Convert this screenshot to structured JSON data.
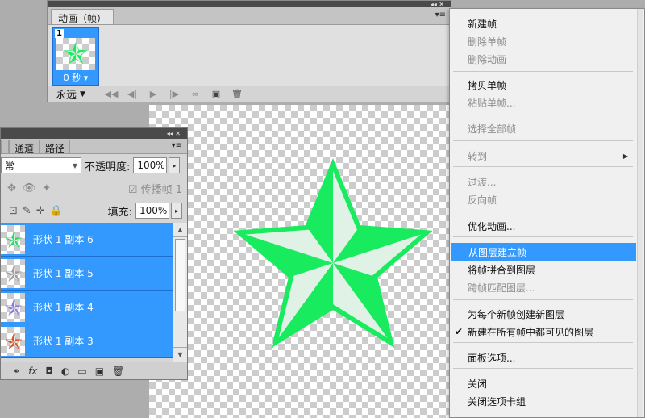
{
  "animation_panel": {
    "tab": "动画（帧）",
    "frame": {
      "number": "1",
      "delay": "0 秒"
    },
    "loop": "永远"
  },
  "layers_panel": {
    "tabs": [
      "",
      "通道",
      "路径"
    ],
    "blend_mode": "常",
    "opacity_label": "不透明度:",
    "opacity_value": "100%",
    "propagate_label": "传播帧 1",
    "fill_label": "填充:",
    "fill_value": "100%",
    "layers": [
      {
        "name": "形状 1 副本 6",
        "star_color": "#2fd36a"
      },
      {
        "name": "形状 1 副本 5",
        "star_color": "#9a9a9a"
      },
      {
        "name": "形状 1 副本 4",
        "star_color": "#8a7ad8"
      },
      {
        "name": "形状 1 副本 3",
        "star_color": "#d0572a"
      }
    ]
  },
  "canvas": {
    "star_color": "#18ec5e"
  },
  "context_menu": {
    "items": [
      {
        "label": "新建帧",
        "disabled": false
      },
      {
        "label": "删除单帧",
        "disabled": true
      },
      {
        "label": "删除动画",
        "disabled": true
      },
      {
        "label": "拷贝单帧",
        "disabled": false
      },
      {
        "label": "粘贴单帧...",
        "disabled": true
      },
      {
        "label": "选择全部帧",
        "disabled": true
      },
      {
        "label": "转到",
        "disabled": true
      },
      {
        "label": "过渡...",
        "disabled": true
      },
      {
        "label": "反向帧",
        "disabled": true
      },
      {
        "label": "优化动画...",
        "disabled": false
      },
      {
        "label": "从图层建立帧",
        "disabled": false,
        "highlighted": true
      },
      {
        "label": "将帧拼合到图层",
        "disabled": false
      },
      {
        "label": "跨帧匹配图层...",
        "disabled": true
      },
      {
        "label": "为每个新帧创建新图层",
        "disabled": false
      },
      {
        "label": "新建在所有帧中都可见的图层",
        "disabled": false,
        "checked": true
      },
      {
        "label": "面板选项...",
        "disabled": false
      },
      {
        "label": "关闭",
        "disabled": false
      },
      {
        "label": "关闭选项卡组",
        "disabled": false
      }
    ]
  },
  "colors": {
    "highlight": "#3399ff",
    "panel": "#d6d6d6",
    "background": "#adadad"
  }
}
